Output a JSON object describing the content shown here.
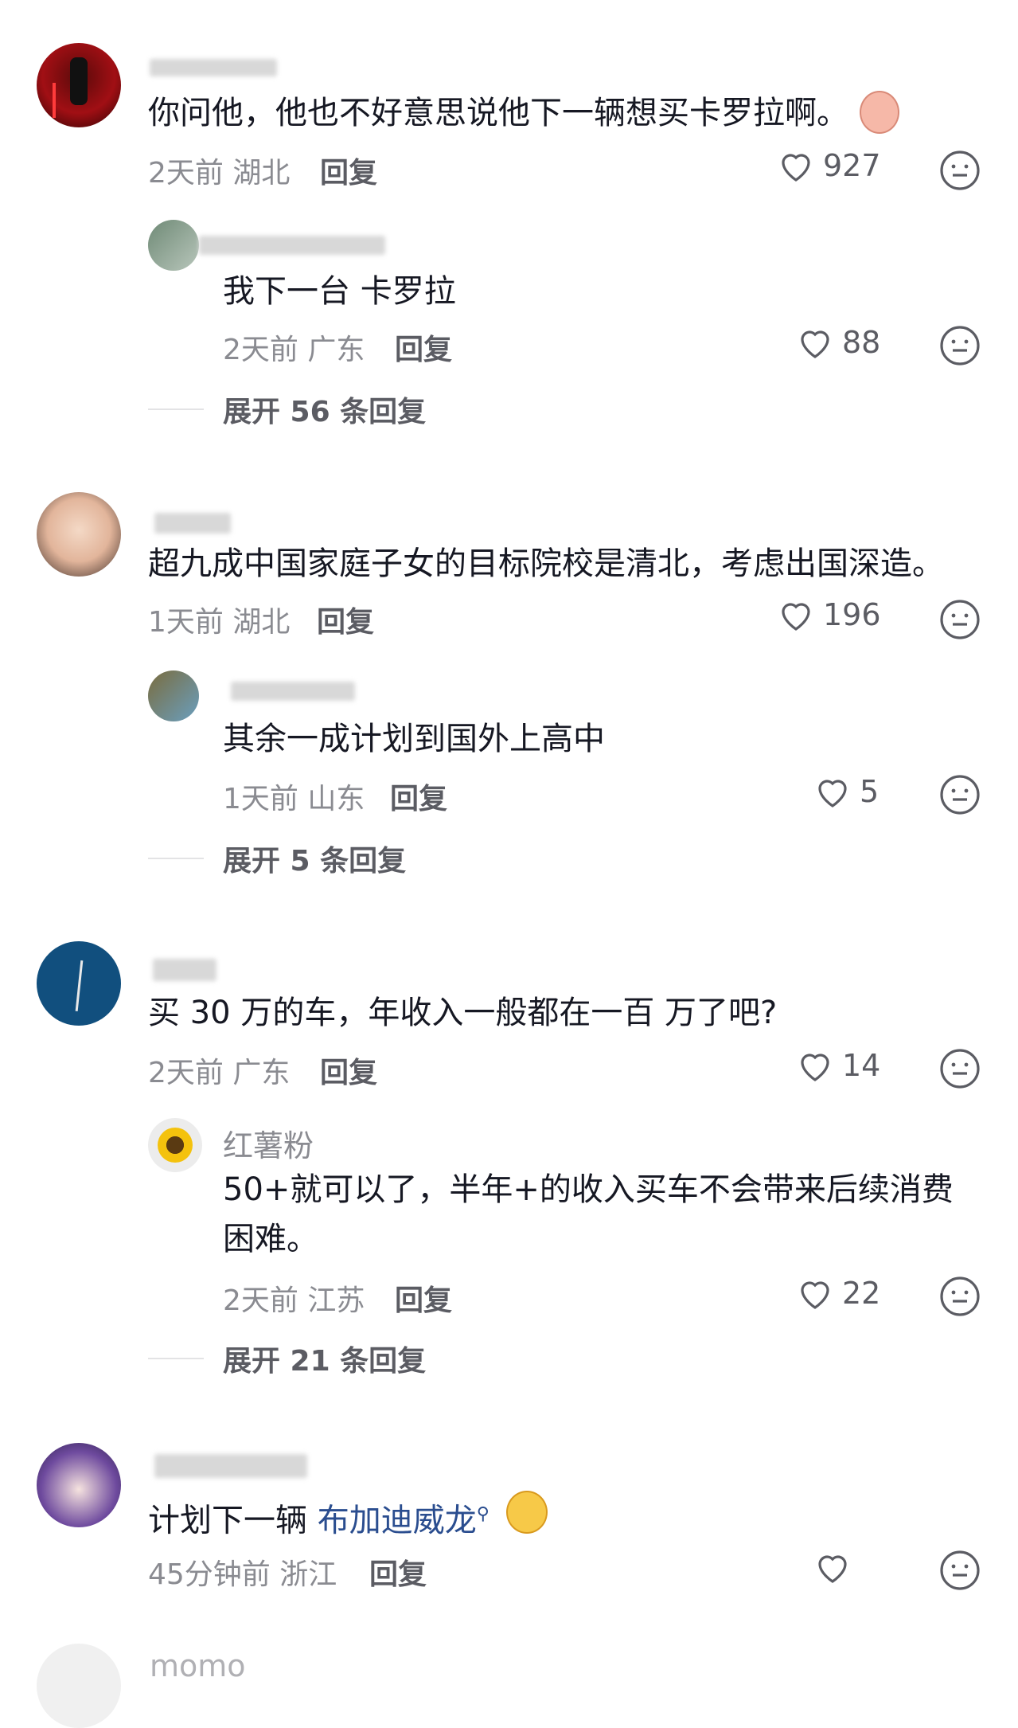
{
  "comments": [
    {
      "content": "你问他，他也不好意思说他下一辆想买卡罗拉啊。",
      "time": "2天前",
      "location": "湖北",
      "reply_label": "回复",
      "likes": "927",
      "replies": [
        {
          "content": "我下一台 卡罗拉",
          "time": "2天前",
          "location": "广东",
          "reply_label": "回复",
          "likes": "88"
        }
      ],
      "expand_label": "展开 56 条回复"
    },
    {
      "content": "超九成中国家庭子女的目标院校是清北，考虑出国深造。",
      "time": "1天前",
      "location": "湖北",
      "reply_label": "回复",
      "likes": "196",
      "replies": [
        {
          "content": "其余一成计划到国外上高中",
          "time": "1天前",
          "location": "山东",
          "reply_label": "回复",
          "likes": "5"
        }
      ],
      "expand_label": "展开 5 条回复"
    },
    {
      "content": "买 30 万的车，年收入一般都在一百 万了吧?",
      "time": "2天前",
      "location": "广东",
      "reply_label": "回复",
      "likes": "14",
      "replies": [
        {
          "name": "红薯粉",
          "content_line1": "50+就可以了，半年+的收入买车不会带来后续消费",
          "content_line2": "困难。",
          "time": "2天前",
          "location": "江苏",
          "reply_label": "回复",
          "likes": "22"
        }
      ],
      "expand_label": "展开 21 条回复"
    },
    {
      "content_prefix": "计划下一辆 ",
      "content_link": "布加迪威龙",
      "time": "45分钟前",
      "location": "浙江",
      "reply_label": "回复",
      "likes": ""
    }
  ],
  "partial_next_name": "momo",
  "icons": {
    "like": "heart-outline-icon",
    "dislike": "meh-face-icon",
    "search": "search-icon"
  },
  "colors": {
    "text": "#161823",
    "meta": "#8a8b91",
    "link": "#2a4d8f"
  }
}
